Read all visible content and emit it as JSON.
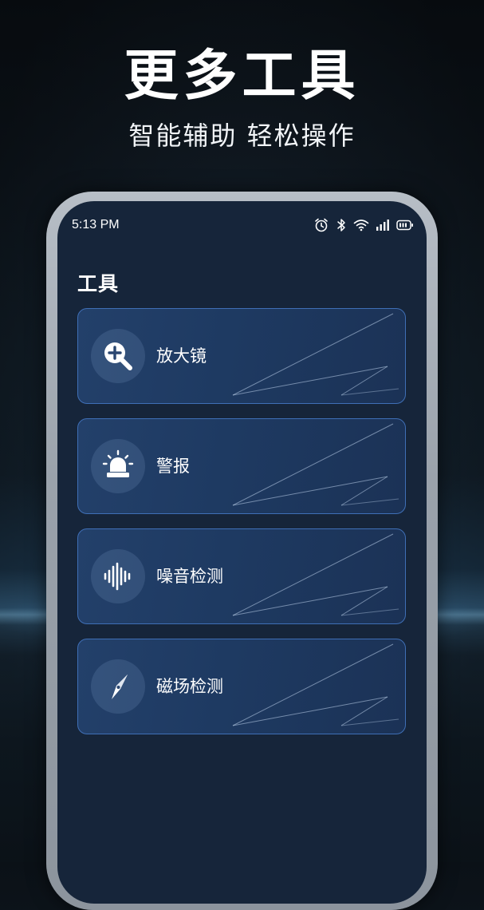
{
  "promo": {
    "headline": "更多工具",
    "subline": "智能辅助 轻松操作"
  },
  "status_bar": {
    "time": "5:13 PM",
    "icons": [
      "alarm-icon",
      "bluetooth-icon",
      "wifi-icon",
      "signal-icon",
      "battery-icon"
    ]
  },
  "screen": {
    "title": "工具",
    "tools": [
      {
        "label": "放大镜",
        "icon": "magnifier-plus-icon"
      },
      {
        "label": "警报",
        "icon": "siren-icon"
      },
      {
        "label": "噪音检测",
        "icon": "sound-wave-icon"
      },
      {
        "label": "磁场检测",
        "icon": "compass-icon"
      }
    ]
  },
  "colors": {
    "card_border": "#3f6fb6",
    "screen_bg": "#16253a",
    "card_bg": "#23406a"
  }
}
